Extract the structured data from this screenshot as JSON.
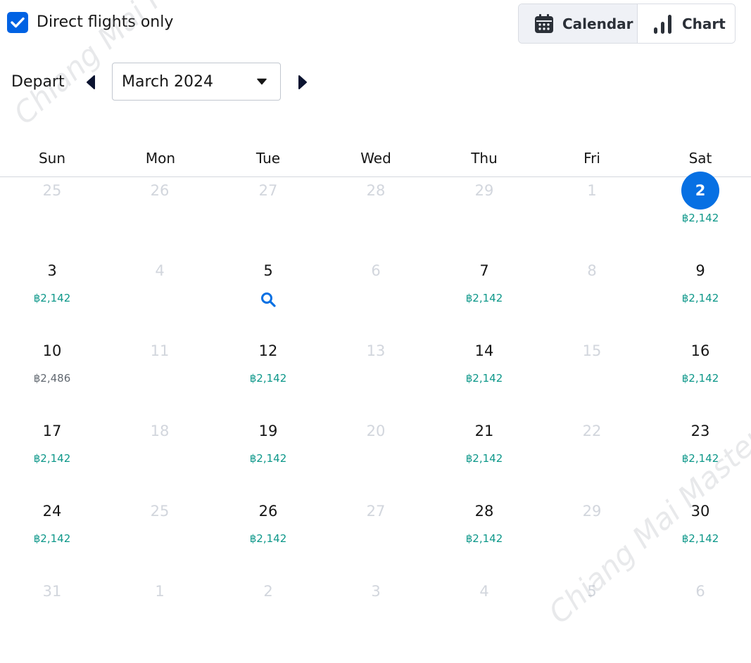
{
  "filters": {
    "direct_only_label": "Direct flights only",
    "direct_only_checked": true
  },
  "view_toggle": {
    "calendar_label": "Calendar",
    "chart_label": "Chart",
    "active": "calendar"
  },
  "month_nav": {
    "label": "Depart",
    "selected_month": "March 2024",
    "prev_icon": "caret-left-icon",
    "next_icon": "caret-right-icon"
  },
  "weekdays": [
    "Sun",
    "Mon",
    "Tue",
    "Wed",
    "Thu",
    "Fri",
    "Sat"
  ],
  "weeks": [
    [
      {
        "day": "25",
        "in_month": false,
        "price": ""
      },
      {
        "day": "26",
        "in_month": false,
        "price": ""
      },
      {
        "day": "27",
        "in_month": false,
        "price": ""
      },
      {
        "day": "28",
        "in_month": false,
        "price": ""
      },
      {
        "day": "29",
        "in_month": false,
        "price": ""
      },
      {
        "day": "1",
        "in_month": false,
        "price": ""
      },
      {
        "day": "2",
        "in_month": true,
        "price": "฿2,142",
        "selected": true
      }
    ],
    [
      {
        "day": "3",
        "in_month": true,
        "price": "฿2,142"
      },
      {
        "day": "4",
        "in_month": false,
        "price": ""
      },
      {
        "day": "5",
        "in_month": true,
        "price": "",
        "search": true
      },
      {
        "day": "6",
        "in_month": false,
        "price": ""
      },
      {
        "day": "7",
        "in_month": true,
        "price": "฿2,142"
      },
      {
        "day": "8",
        "in_month": false,
        "price": ""
      },
      {
        "day": "9",
        "in_month": true,
        "price": "฿2,142"
      }
    ],
    [
      {
        "day": "10",
        "in_month": true,
        "price": "฿2,486",
        "high": true
      },
      {
        "day": "11",
        "in_month": false,
        "price": ""
      },
      {
        "day": "12",
        "in_month": true,
        "price": "฿2,142"
      },
      {
        "day": "13",
        "in_month": false,
        "price": ""
      },
      {
        "day": "14",
        "in_month": true,
        "price": "฿2,142"
      },
      {
        "day": "15",
        "in_month": false,
        "price": ""
      },
      {
        "day": "16",
        "in_month": true,
        "price": "฿2,142"
      }
    ],
    [
      {
        "day": "17",
        "in_month": true,
        "price": "฿2,142"
      },
      {
        "day": "18",
        "in_month": false,
        "price": ""
      },
      {
        "day": "19",
        "in_month": true,
        "price": "฿2,142"
      },
      {
        "day": "20",
        "in_month": false,
        "price": ""
      },
      {
        "day": "21",
        "in_month": true,
        "price": "฿2,142"
      },
      {
        "day": "22",
        "in_month": false,
        "price": ""
      },
      {
        "day": "23",
        "in_month": true,
        "price": "฿2,142"
      }
    ],
    [
      {
        "day": "24",
        "in_month": true,
        "price": "฿2,142"
      },
      {
        "day": "25",
        "in_month": false,
        "price": ""
      },
      {
        "day": "26",
        "in_month": true,
        "price": "฿2,142"
      },
      {
        "day": "27",
        "in_month": false,
        "price": ""
      },
      {
        "day": "28",
        "in_month": true,
        "price": "฿2,142"
      },
      {
        "day": "29",
        "in_month": false,
        "price": ""
      },
      {
        "day": "30",
        "in_month": true,
        "price": "฿2,142"
      }
    ],
    [
      {
        "day": "31",
        "in_month": false,
        "price": ""
      },
      {
        "day": "1",
        "in_month": false,
        "price": ""
      },
      {
        "day": "2",
        "in_month": false,
        "price": ""
      },
      {
        "day": "3",
        "in_month": false,
        "price": ""
      },
      {
        "day": "4",
        "in_month": false,
        "price": ""
      },
      {
        "day": "5",
        "in_month": false,
        "price": ""
      },
      {
        "day": "6",
        "in_month": false,
        "price": ""
      }
    ]
  ],
  "colors": {
    "accent": "#0770e3",
    "price_low": "#0c9789",
    "price_high": "#626971",
    "dim_text": "#d2d6dd"
  },
  "watermark": "Chiang Mai Master"
}
